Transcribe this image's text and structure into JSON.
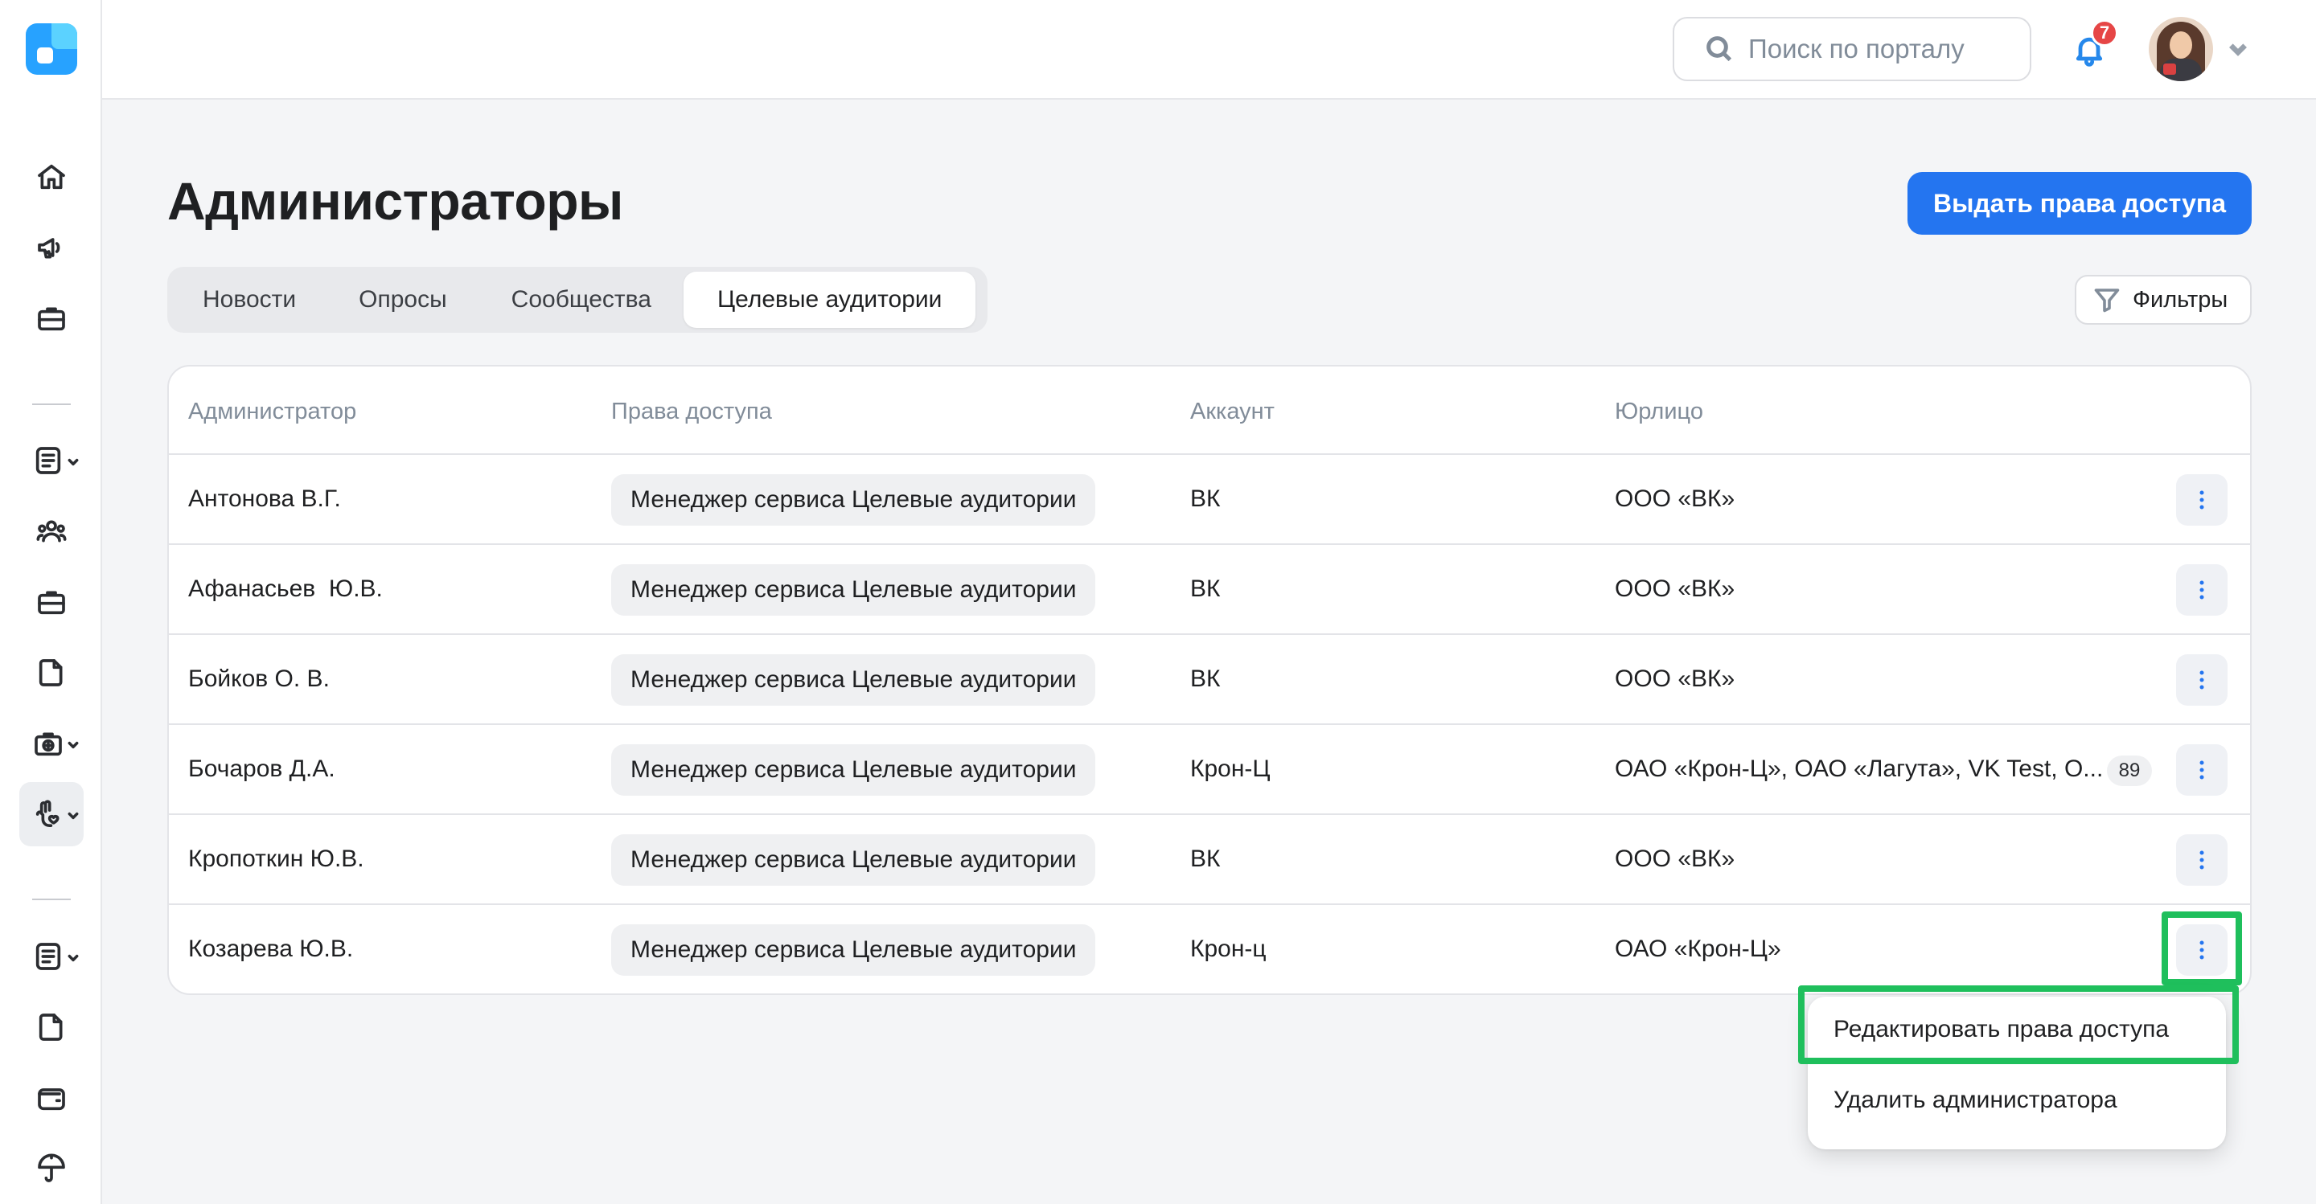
{
  "header": {
    "search_placeholder": "Поиск по порталу",
    "notifications_count": "7"
  },
  "page": {
    "title": "Администраторы",
    "primary_action": "Выдать права доступа",
    "filters_label": "Фильтры"
  },
  "tabs": [
    {
      "label": "Новости",
      "active": false
    },
    {
      "label": "Опросы",
      "active": false
    },
    {
      "label": "Сообщества",
      "active": false
    },
    {
      "label": "Целевые аудитории",
      "active": true
    }
  ],
  "table": {
    "columns": [
      "Администратор",
      "Права доступа",
      "Аккаунт",
      "Юрлицо"
    ],
    "rows": [
      {
        "admin": "Антонова В.Г.",
        "access": "Менеджер сервиса Целевые аудитории",
        "account": "ВК",
        "entity": "ООО «ВК»",
        "extra": ""
      },
      {
        "admin": "Афанасьев  Ю.В.",
        "access": "Менеджер сервиса Целевые аудитории",
        "account": "ВК",
        "entity": "ООО «ВК»",
        "extra": ""
      },
      {
        "admin": "Бойков О. В.",
        "access": "Менеджер сервиса Целевые аудитории",
        "account": "ВК",
        "entity": "ООО «ВК»",
        "extra": ""
      },
      {
        "admin": "Бочаров Д.А.",
        "access": "Менеджер сервиса Целевые аудитории",
        "account": "Крон-Ц",
        "entity": "ОАО «Крон-Ц», ОАО «Лагута», VK Test, О...",
        "extra": "89"
      },
      {
        "admin": "Кропоткин Ю.В.",
        "access": "Менеджер сервиса Целевые аудитории",
        "account": "ВК",
        "entity": "ООО «ВК»",
        "extra": ""
      },
      {
        "admin": "Козарева Ю.В.",
        "access": "Менеджер сервиса Целевые аудитории",
        "account": "Крон-ц",
        "entity": "ОАО «Крон-Ц»",
        "extra": ""
      }
    ]
  },
  "row_menu": {
    "items": [
      "Редактировать права доступа",
      "Удалить администратора"
    ]
  },
  "colors": {
    "accent": "#2475f0",
    "highlight": "#1fbf5c",
    "badge": "#e64646"
  },
  "icons": {
    "rail": [
      "home-icon",
      "megaphone-icon",
      "briefcase-icon",
      "document-list-icon",
      "users-icon",
      "briefcase-icon",
      "file-icon",
      "medkit-icon",
      "hand-heart-icon",
      "document-list-icon",
      "file-icon",
      "wallet-icon",
      "umbrella-icon"
    ]
  }
}
